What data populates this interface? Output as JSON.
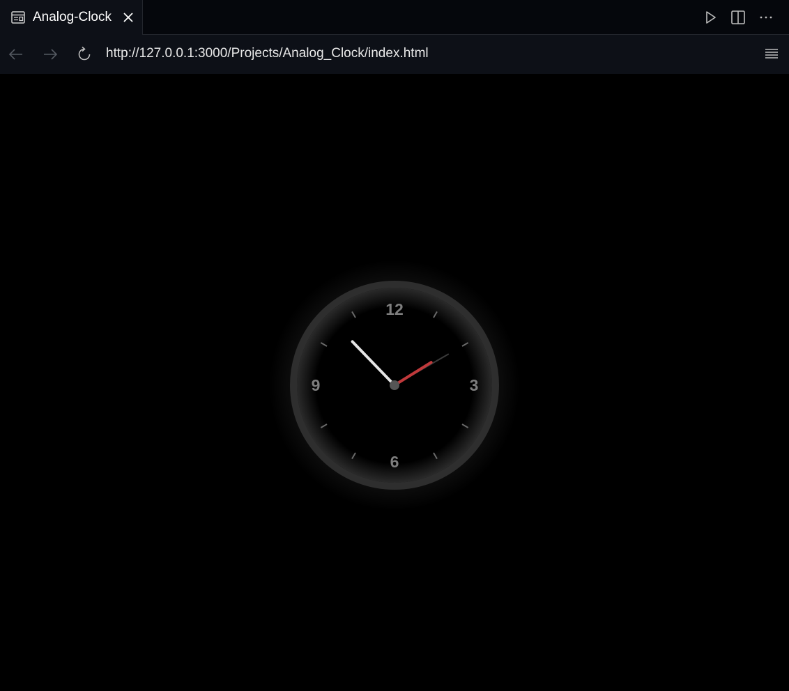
{
  "tab": {
    "title": "Analog-Clock",
    "icon": "browser-preview-icon"
  },
  "toolbar_actions": [
    "run-icon",
    "split-editor-icon",
    "more-icon"
  ],
  "navigation": {
    "url": "http://127.0.0.1:3000/Projects/Analog_Clock/index.html",
    "back_icon": "back-arrow-icon",
    "forward_icon": "forward-arrow-icon",
    "reload_icon": "reload-icon",
    "menu_icon": "menu-icon"
  },
  "clock": {
    "numerals": {
      "twelve": "12",
      "three": "3",
      "six": "6",
      "nine": "9"
    },
    "time": {
      "hours": 10,
      "minutes": 10,
      "seconds": 10
    },
    "colors": {
      "ring": "#2e2e2e",
      "face": "#000000",
      "hour_hand": "#e6e6e6",
      "minute_hand": "#c0393b",
      "second_hand": "#3a3a3a",
      "numerals": "#7e7e7e",
      "ticks": "#6a6a6a"
    }
  }
}
